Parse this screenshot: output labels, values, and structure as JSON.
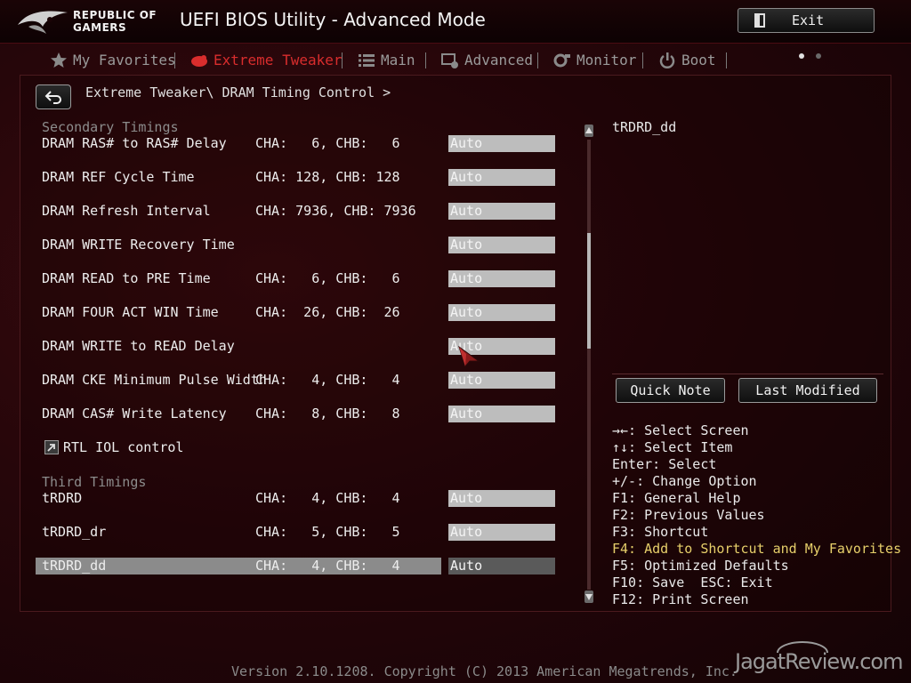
{
  "header": {
    "brand_line1": "REPUBLIC OF",
    "brand_line2": "GAMERS",
    "title": "UEFI BIOS Utility - Advanced Mode",
    "exit_label": "Exit"
  },
  "nav": {
    "tabs": [
      {
        "label": "My Favorites",
        "icon": "star-icon",
        "active": false
      },
      {
        "label": "Extreme Tweaker",
        "icon": "tweaker-icon",
        "active": true
      },
      {
        "label": "Main",
        "icon": "list-icon",
        "active": false
      },
      {
        "label": "Advanced",
        "icon": "advanced-icon",
        "active": false
      },
      {
        "label": "Monitor",
        "icon": "monitor-icon",
        "active": false
      },
      {
        "label": "Boot",
        "icon": "power-icon",
        "active": false
      }
    ]
  },
  "breadcrumb": "Extreme Tweaker\\ DRAM Timing Control >",
  "sections": {
    "secondary": "Secondary Timings",
    "third": "Third Timings"
  },
  "rows": [
    {
      "label": "DRAM RAS# to RAS# Delay",
      "values": "CHA:   6, CHB:   6",
      "field": "Auto"
    },
    {
      "label": "DRAM REF Cycle Time",
      "values": "CHA: 128, CHB: 128",
      "field": "Auto"
    },
    {
      "label": "DRAM Refresh Interval",
      "values": "CHA: 7936, CHB: 7936",
      "field": "Auto"
    },
    {
      "label": "DRAM WRITE Recovery Time",
      "values": "",
      "field": "Auto"
    },
    {
      "label": "DRAM READ to PRE Time",
      "values": "CHA:   6, CHB:   6",
      "field": "Auto"
    },
    {
      "label": "DRAM FOUR ACT WIN Time",
      "values": "CHA:  26, CHB:  26",
      "field": "Auto"
    },
    {
      "label": "DRAM WRITE to READ Delay",
      "values": "",
      "field": "Auto"
    },
    {
      "label": "DRAM CKE Minimum Pulse Width",
      "values": "CHA:   4, CHB:   4",
      "field": "Auto"
    },
    {
      "label": "DRAM CAS# Write Latency",
      "values": "CHA:   8, CHB:   8",
      "field": "Auto"
    },
    {
      "label": "RTL IOL control"
    },
    {
      "label": "tRDRD",
      "values": "CHA:   4, CHB:   4",
      "field": "Auto"
    },
    {
      "label": "tRDRD_dr",
      "values": "CHA:   5, CHB:   5",
      "field": "Auto"
    },
    {
      "label": "tRDRD_dd",
      "values": "CHA:   4, CHB:   4",
      "field": "Auto"
    }
  ],
  "help": {
    "title": "tRDRD_dd",
    "quick_note": "Quick Note",
    "last_modified": "Last Modified",
    "keys": [
      "→←: Select Screen",
      "↑↓: Select Item",
      "Enter: Select",
      "+/-: Change Option",
      "F1: General Help",
      "F2: Previous Values",
      "F3: Shortcut",
      "F4: Add to Shortcut and My Favorites",
      "F5: Optimized Defaults",
      "F10: Save  ESC: Exit",
      "F12: Print Screen"
    ]
  },
  "footer": "Version 2.10.1208. Copyright (C) 2013 American Megatrends, Inc.",
  "watermark": "JagatReview.com",
  "colors": {
    "accent": "#d92d2d",
    "highlight": "#e6cf6a",
    "background": "#26060a"
  }
}
